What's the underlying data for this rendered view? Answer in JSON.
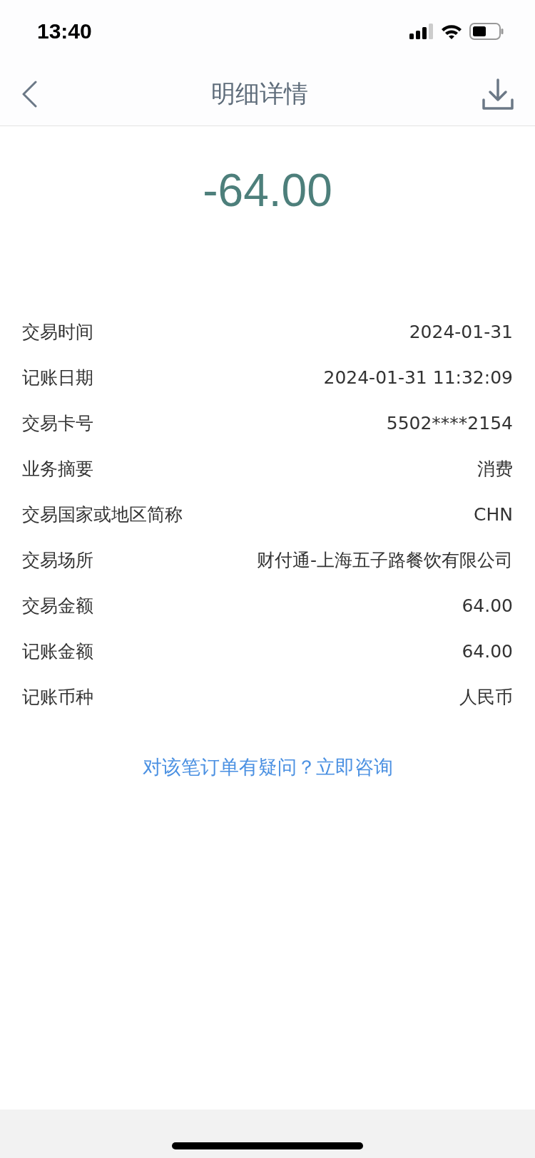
{
  "status_bar": {
    "time": "13:40"
  },
  "nav": {
    "title": "明细详情"
  },
  "amount": "-64.00",
  "details": [
    {
      "label": "交易时间",
      "value": "2024-01-31"
    },
    {
      "label": "记账日期",
      "value": "2024-01-31 11:32:09"
    },
    {
      "label": "交易卡号",
      "value": "5502****2154"
    },
    {
      "label": "业务摘要",
      "value": "消费"
    },
    {
      "label": "交易国家或地区简称",
      "value": "CHN"
    },
    {
      "label": "交易场所",
      "value": "财付通-上海五子路餐饮有限公司"
    },
    {
      "label": "交易金额",
      "value": "64.00"
    },
    {
      "label": "记账金额",
      "value": "64.00"
    },
    {
      "label": "记账币种",
      "value": "人民币"
    }
  ],
  "inquiry_link": "对该笔订单有疑问？立即咨询"
}
